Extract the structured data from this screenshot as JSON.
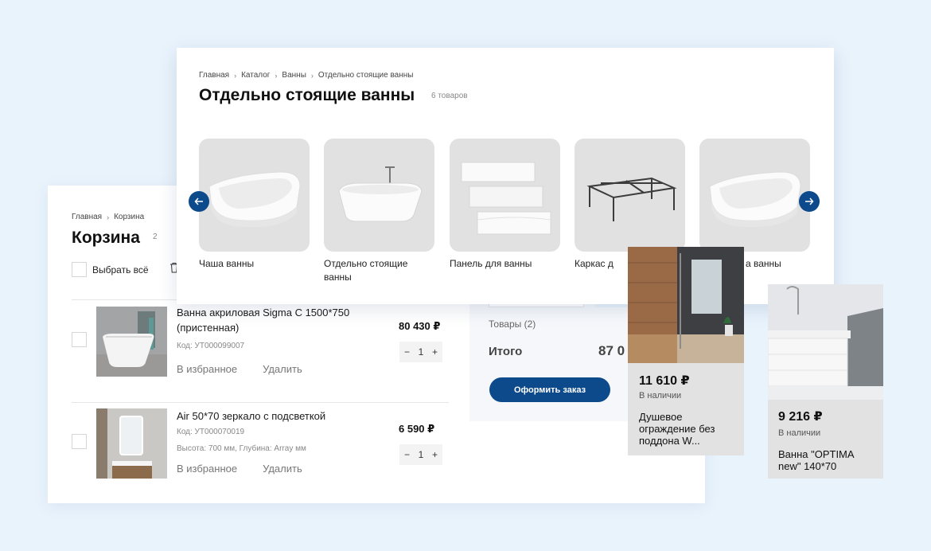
{
  "cart": {
    "breadcrumbs": [
      "Главная",
      "Корзина"
    ],
    "title": "Корзина",
    "count": "2",
    "select_all": "Выбрать всё",
    "items": [
      {
        "name": "Ванна акриловая Sigma C 1500*750 (пристенная)",
        "code": "Код: УТ000099007",
        "price": "80 430 ₽",
        "qty": "1",
        "favorite": "В избранное",
        "remove": "Удалить"
      },
      {
        "name": "Air 50*70 зеркало с подсветкой",
        "code": "Код: УТ000070019",
        "dims": "Высота: 700 мм, Глубина: Array мм",
        "price": "6 590 ₽",
        "qty": "1",
        "favorite": "В избранное",
        "remove": "Удалить"
      }
    ],
    "summary": {
      "goods": "Товары",
      "goods_count": "(2)",
      "total_label": "Итого",
      "total_value": "87 0",
      "order_button": "Оформить заказ"
    },
    "stepper": {
      "minus": "−",
      "plus": "+"
    }
  },
  "catalog": {
    "breadcrumbs": [
      "Главная",
      "Каталог",
      "Ванны",
      "Отдельно стоящие ванны"
    ],
    "title": "Отдельно стоящие ванны",
    "count": "6 товаров",
    "categories": [
      {
        "label": "Чаша ванны",
        "icon": "corner-bathtub"
      },
      {
        "label": "Отдельно стоящие ванны",
        "icon": "freestanding-bathtub"
      },
      {
        "label": "Панель для ванны",
        "icon": "bath-panel"
      },
      {
        "label": "Каркас д",
        "icon": "bath-frame"
      },
      {
        "label": "а ванны",
        "icon": "corner-bathtub"
      }
    ]
  },
  "products": [
    {
      "price": "11 610 ₽",
      "stock": "В наличии",
      "name": "Душевое ограждение без поддона W..."
    },
    {
      "price": "9 216 ₽",
      "stock": "В наличии",
      "name": "Ванна \"OPTIMA new\" 140*70"
    }
  ],
  "colors": {
    "accent": "#0d4a8c",
    "background": "#e9f3fc",
    "card": "#e2e2e2"
  }
}
